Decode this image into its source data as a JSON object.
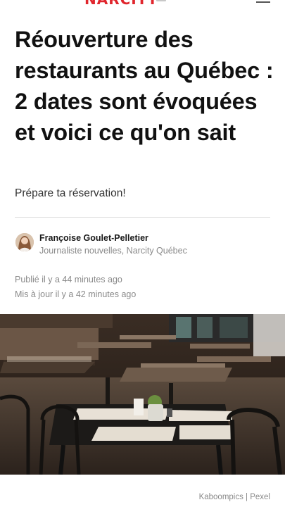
{
  "header": {
    "logo_text": "NARCITY",
    "menu_icon": "hamburger-menu-icon",
    "brand_color": "#e0262d"
  },
  "article": {
    "title": "Réouverture des restaurants au Québec : 2 dates sont évoquées et voici ce qu'on sait",
    "subtitle": "Prépare ta réservation!",
    "author": {
      "name": "Françoise Goulet-Pelletier",
      "role": "Journaliste nouvelles, Narcity Québec"
    },
    "published": "Publié il y a 44 minutes ago",
    "updated": "Mis à jour il y a 42 minutes ago",
    "image": {
      "description_icon": "restaurant-photo",
      "credit": "Kaboompics | Pexel"
    }
  }
}
